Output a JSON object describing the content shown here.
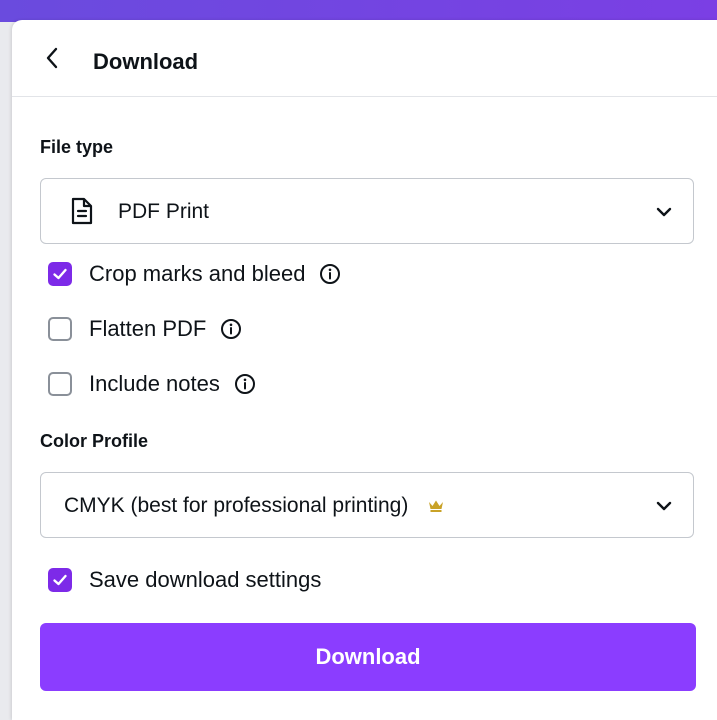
{
  "header": {
    "title": "Download",
    "back_icon": "chevron-left-icon"
  },
  "file_type": {
    "label": "File type",
    "selected": "PDF Print",
    "icon": "document-icon"
  },
  "options": [
    {
      "label": "Crop marks and bleed",
      "checked": true,
      "has_info": true
    },
    {
      "label": "Flatten PDF",
      "checked": false,
      "has_info": true
    },
    {
      "label": "Include notes",
      "checked": false,
      "has_info": true
    }
  ],
  "color_profile": {
    "label": "Color Profile",
    "selected": "CMYK (best for professional printing)",
    "badge_icon": "crown-icon"
  },
  "save_settings": {
    "label": "Save download settings",
    "checked": true
  },
  "download_button": {
    "label": "Download"
  },
  "colors": {
    "accent": "#8b3dff",
    "checkbox": "#7d2ae8",
    "top_bar": "#6a4bde"
  }
}
